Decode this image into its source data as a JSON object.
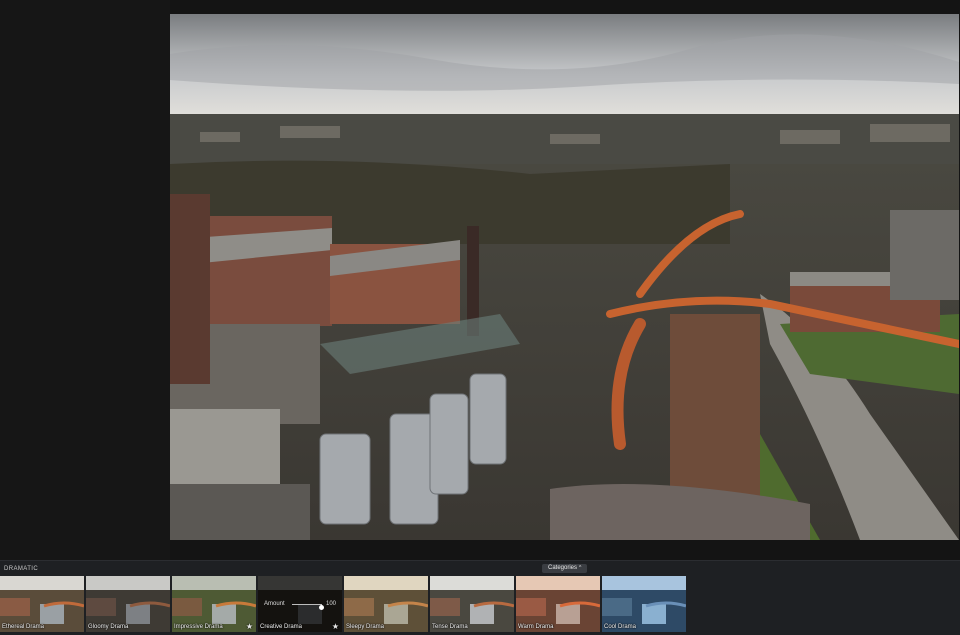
{
  "filmstrip": {
    "section_label": "DRAMATIC",
    "categories_label": "Categories",
    "categories_caret": "^",
    "presets": [
      {
        "label": "Ethereal Drama",
        "starred": false,
        "selected": false,
        "tint": "#d8c8b0"
      },
      {
        "label": "Gloomy Drama",
        "starred": false,
        "selected": false,
        "tint": "#7a7a72"
      },
      {
        "label": "Impressive Drama",
        "starred": true,
        "selected": false,
        "tint": "#9aa06a"
      },
      {
        "label": "Creative Drama",
        "starred": true,
        "selected": true,
        "tint": "#555"
      },
      {
        "label": "Sleepy Drama",
        "starred": false,
        "selected": false,
        "tint": "#b0986a"
      },
      {
        "label": "Tense Drama",
        "starred": false,
        "selected": false,
        "tint": "#a8a8a0"
      },
      {
        "label": "Warm Drama",
        "starred": false,
        "selected": false,
        "tint": "#c07858"
      },
      {
        "label": "Cool Drama",
        "starred": false,
        "selected": false,
        "tint": "#5a86b8"
      }
    ],
    "amount": {
      "label": "Amount",
      "value": "100",
      "level": 1.0,
      "star": "★"
    }
  },
  "icons": {
    "star": "★"
  },
  "colors": {
    "background": "#141414",
    "filmstrip": "#1e2023",
    "accent": "#d8d8d8"
  }
}
